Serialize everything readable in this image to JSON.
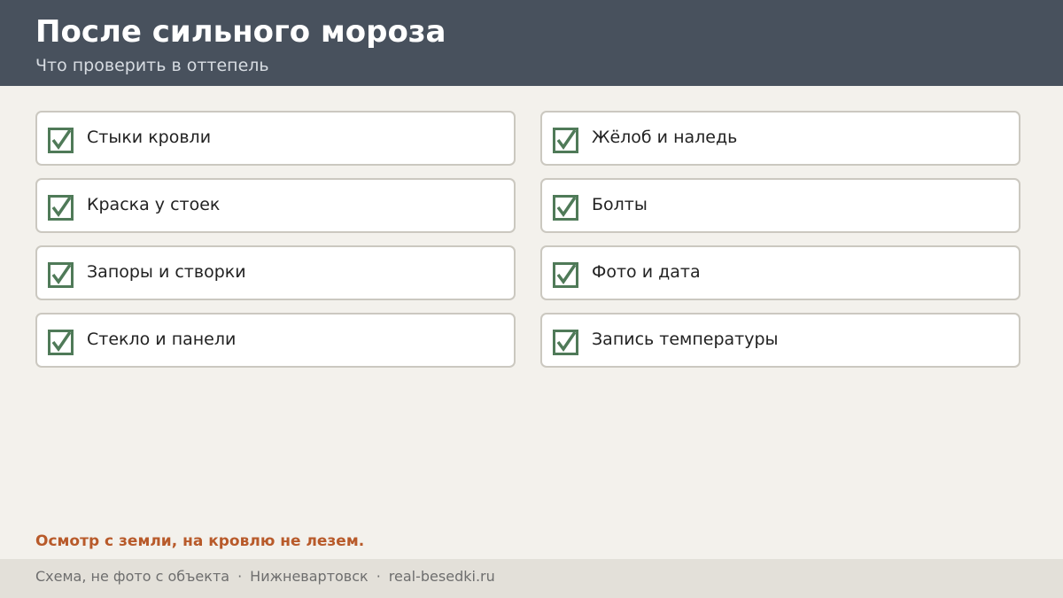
{
  "header": {
    "title": "После сильного мороза",
    "subtitle": "Что проверить в оттепель"
  },
  "checklist": {
    "left": [
      {
        "label": "Стыки кровли",
        "checked": true
      },
      {
        "label": "Краска у стоек",
        "checked": true
      },
      {
        "label": "Запоры и створки",
        "checked": true
      },
      {
        "label": "Стекло и панели",
        "checked": true
      }
    ],
    "right": [
      {
        "label": "Жёлоб и наледь",
        "checked": true
      },
      {
        "label": "Болты",
        "checked": true
      },
      {
        "label": "Фото и дата",
        "checked": true
      },
      {
        "label": "Запись температуры",
        "checked": true
      }
    ]
  },
  "note": "Осмотр с земли, на кровлю не лезем.",
  "footer": {
    "part1": "Схема, не фото с объекта",
    "separator": "·",
    "part2": "Нижневартовск",
    "part3": "real-besedki.ru"
  },
  "colors": {
    "header_bg": "#48515d",
    "page_bg": "#f3f1ec",
    "check_green": "#4f7a58",
    "note_orange": "#b85a2a",
    "footer_bg": "#e3e0d9"
  },
  "icons": {
    "checkbox": "checkbox-checked-icon"
  }
}
